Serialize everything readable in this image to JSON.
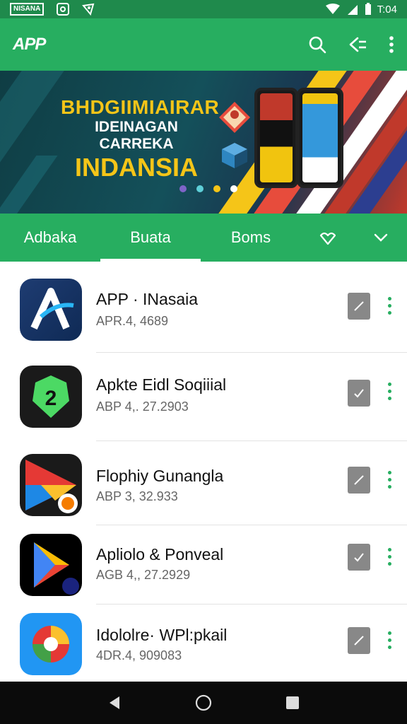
{
  "status_bar": {
    "left_badge": "NISANA",
    "time": "T:04"
  },
  "app_bar": {
    "logo": "APP"
  },
  "banner": {
    "line1": "BHDGIIMIAIRAR",
    "line2": "IDEINAGAN CARREKA",
    "line3": "INDANSIA",
    "page_indicator_count": 4,
    "page_indicator_active": 3
  },
  "tabs": [
    {
      "label": "Adbaka",
      "active": false
    },
    {
      "label": "Buata",
      "active": true
    },
    {
      "label": "Boms",
      "active": false
    }
  ],
  "apps": [
    {
      "name": "APP · INasaia",
      "version": "APR.4, 4689"
    },
    {
      "name": "Apkte Eidl Soqiiial",
      "version": "ABP 4,. 27.2903"
    },
    {
      "name": "Flophiy Gunangla",
      "version": "ABP 3, 32.933"
    },
    {
      "name": "Apliolo & Ponveal",
      "version": "AGB 4,, 27.2929"
    },
    {
      "name": "Idololre· WPl:pkail",
      "version": "4DR.4, 909083"
    }
  ],
  "colors": {
    "primary": "#27ae60",
    "status_bar": "#1f8a4c",
    "banner_yellow": "#f5c518"
  }
}
